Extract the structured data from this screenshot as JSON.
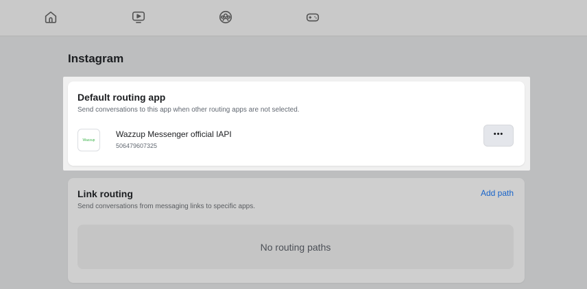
{
  "nav": {
    "icons": [
      "home-icon",
      "video-icon",
      "groups-icon",
      "gaming-icon"
    ]
  },
  "page": {
    "title": "Instagram"
  },
  "default_routing": {
    "title": "Default routing app",
    "subtitle": "Send conversations to this app when other routing apps are not selected.",
    "app": {
      "logo_text": "Wazzup",
      "name": "Wazzup Messenger official IAPI",
      "id": "506479607325"
    },
    "more_label": "•••"
  },
  "link_routing": {
    "title": "Link routing",
    "subtitle": "Send conversations from messaging links to specific apps.",
    "add_path_label": "Add path",
    "empty_label": "No routing paths"
  },
  "colors": {
    "accent": "#1763c9",
    "logo_green": "#3cb44a"
  }
}
